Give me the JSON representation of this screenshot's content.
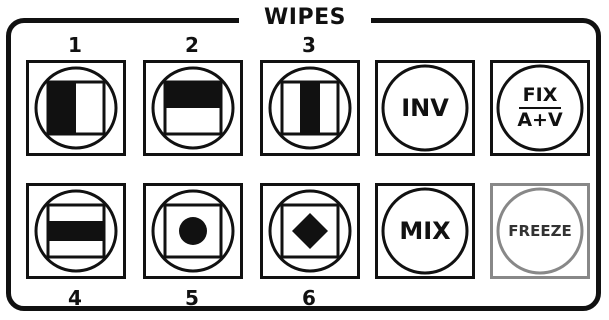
{
  "panel": {
    "title": "WIPES",
    "wipe_numbers": [
      "1",
      "2",
      "3",
      "4",
      "5",
      "6"
    ],
    "buttons": {
      "inv": "INV",
      "fix_top": "FIX",
      "fix_bottom": "A+V",
      "mix": "MIX",
      "freeze": "FREEZE"
    },
    "wipe_patterns": [
      "vertical-split-left",
      "horizontal-split-top",
      "vertical-center-bar",
      "horizontal-center-bar",
      "circle-iris",
      "diamond-iris"
    ]
  }
}
